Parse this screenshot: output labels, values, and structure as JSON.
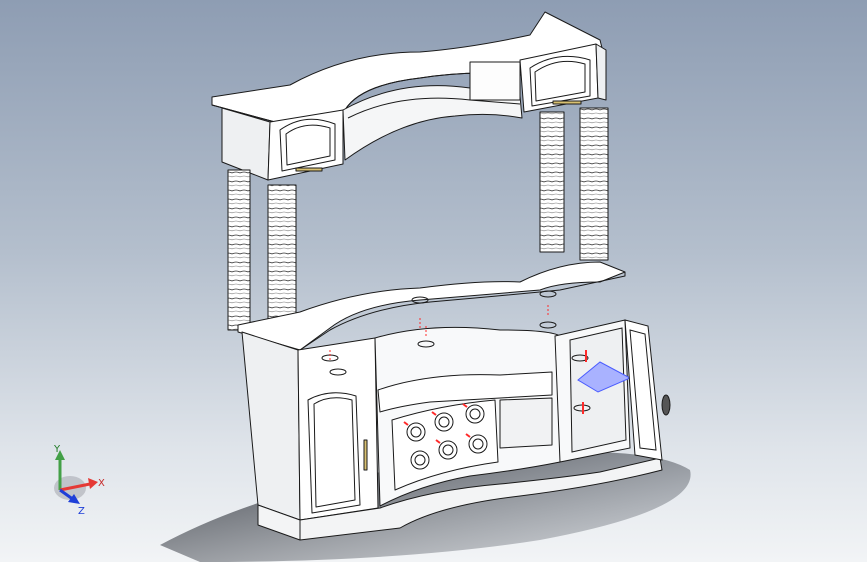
{
  "viewport": {
    "background_top": "#8e9db3",
    "background_bottom": "#f2f4f6"
  },
  "model": {
    "edge_color": "#1a1a1a",
    "face_color": "#ffffff",
    "shade_color": "#e6e8ea",
    "highlight_color": "#4a5cff",
    "hole_color": "#ff2a2a"
  },
  "triad": {
    "x_label": "X",
    "y_label": "Y",
    "z_label": "Z",
    "x_color": "#e53935",
    "y_color": "#43a047",
    "z_color": "#1e3fd8"
  }
}
